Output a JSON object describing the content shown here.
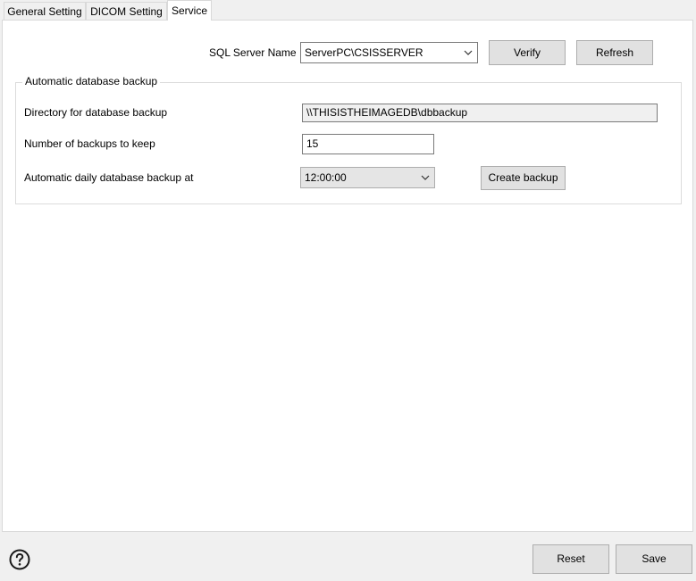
{
  "tabs": [
    {
      "label": "General Setting",
      "active": false
    },
    {
      "label": "DICOM Setting",
      "active": false
    },
    {
      "label": "Service",
      "active": true
    }
  ],
  "service": {
    "sql_server_label": "SQL Server Name",
    "sql_server_value": "ServerPC\\CSISSERVER",
    "verify_label": "Verify",
    "refresh_label": "Refresh"
  },
  "backup": {
    "group_title": "Automatic database backup",
    "directory_label": "Directory for database backup",
    "directory_value": "\\\\THISISTHEIMAGEDB\\dbbackup",
    "count_label": "Number of backups to keep",
    "count_value": "15",
    "time_label": "Automatic daily database backup at",
    "time_value": "12:00:00",
    "create_label": "Create backup"
  },
  "footer": {
    "help_icon": "question-circle-icon",
    "reset_label": "Reset",
    "save_label": "Save"
  },
  "colors": {
    "window_bg": "#f0f0f0",
    "panel_bg": "#ffffff",
    "button_bg": "#e1e1e1",
    "border": "#adadad"
  }
}
